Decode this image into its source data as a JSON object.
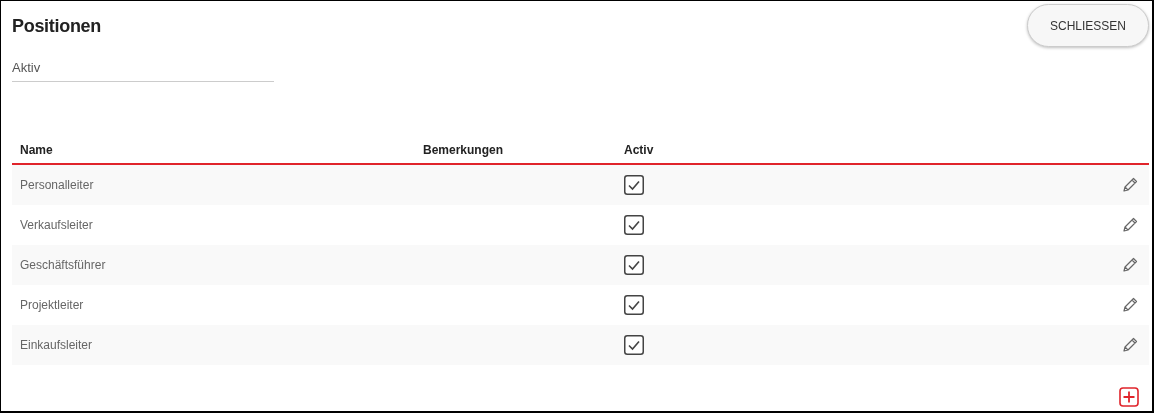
{
  "title": "Positionen",
  "close_button": {
    "label": "SCHLIESSEN"
  },
  "filter_field": {
    "value": "Aktiv"
  },
  "table": {
    "columns": [
      "Name",
      "Bemerkungen",
      "Activ"
    ],
    "rows": [
      {
        "name": "Personalleiter",
        "active": true
      },
      {
        "name": "Verkaufsleiter",
        "active": true
      },
      {
        "name": "Geschäftsführer",
        "active": true
      },
      {
        "name": "Projektleiter",
        "active": true
      },
      {
        "name": "Einkaufsleiter",
        "active": true
      }
    ]
  }
}
